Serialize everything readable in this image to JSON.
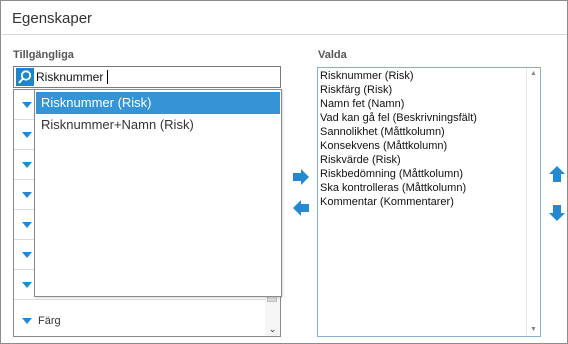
{
  "window": {
    "title": "Egenskaper"
  },
  "available": {
    "label": "Tillgängliga",
    "search_value": "Risknummer",
    "groups": [
      "",
      "",
      "",
      "",
      "",
      "",
      "",
      "Färg"
    ],
    "suggestions": [
      "Risknummer (Risk)",
      "Risknummer+Namn (Risk)"
    ]
  },
  "selected": {
    "label": "Valda",
    "items": [
      "Risknummer (Risk)",
      "Riskfärg (Risk)",
      "Namn fet (Namn)",
      "Vad kan gå fel (Beskrivningsfält)",
      "Sannolikhet (Måttkolumn)",
      "Konsekvens (Måttkolumn)",
      "Riskvärde (Risk)",
      "Riskbedömning (Måttkolumn)",
      "Ska kontrolleras (Måttkolumn)",
      "Kommentar (Kommentarer)"
    ]
  },
  "icons": {
    "search": "search-icon",
    "add": "arrow-right-icon",
    "remove": "arrow-left-icon",
    "move_up": "arrow-up-icon",
    "move_down": "arrow-down-icon",
    "expand": "triangle-down-icon"
  },
  "colors": {
    "accent": "#2688cf",
    "selection": "#3494d6"
  }
}
